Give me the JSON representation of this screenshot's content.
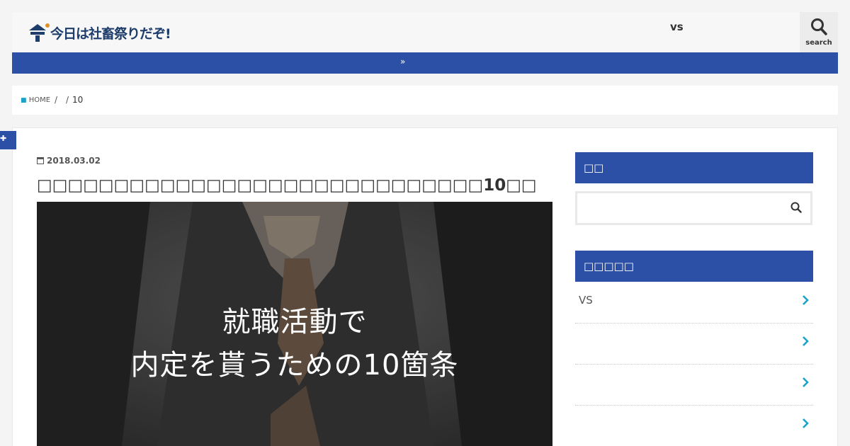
{
  "header": {
    "logo_text": "今日は社畜祭りだぞ!",
    "nav_item": "vs",
    "search_label": "search"
  },
  "bluebar": {
    "icon": "double-chevron-right-icon"
  },
  "breadcrumb": {
    "home": "HOME",
    "sep1": "/",
    "sep2": "/",
    "current": "10"
  },
  "post": {
    "date": "2018.03.02",
    "title": "□□□□□□□□□□□□□□□□□□□□□□□□□□□□□10□□",
    "hero_line1": "就職活動で",
    "hero_line2": "内定を貰うための10箇条"
  },
  "sidebar": {
    "search_title": "□□",
    "new_title": "□□□□□",
    "items": [
      {
        "label": "VS"
      },
      {
        "label": ""
      },
      {
        "label": ""
      },
      {
        "label": ""
      }
    ]
  },
  "colors": {
    "accent": "#2b50a5",
    "chevron": "#1ba3c6"
  }
}
